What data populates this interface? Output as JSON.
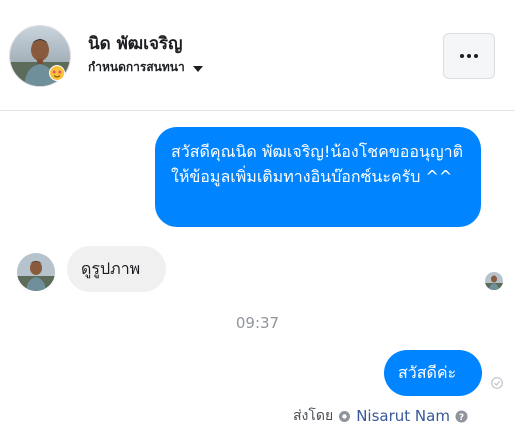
{
  "header": {
    "contact_name": "นิด พัฒเจริญ",
    "nickname_label": "กำหนดการสนทนา",
    "more_icon": "more-horizontal-icon"
  },
  "messages": [
    {
      "direction": "outgoing",
      "text": "สวัสดีคุณนิด พัฒเจริญ!น้องโชคขออนุญาติให้ข้อมูลเพิ่มเติมทางอินบ๊อกซ์นะครับ ^^"
    },
    {
      "direction": "incoming",
      "text": "ดูรูปภาพ"
    },
    {
      "direction": "outgoing",
      "text": "สวัสดีค่ะ"
    }
  ],
  "timestamp": "09:37",
  "sent_by": {
    "label": "ส่งโดย",
    "name": "Nisarut Nam"
  },
  "colors": {
    "outgoing_bubble": "#0084ff",
    "incoming_bubble": "#f1f0f0",
    "reaction_badge": "#f25268"
  }
}
